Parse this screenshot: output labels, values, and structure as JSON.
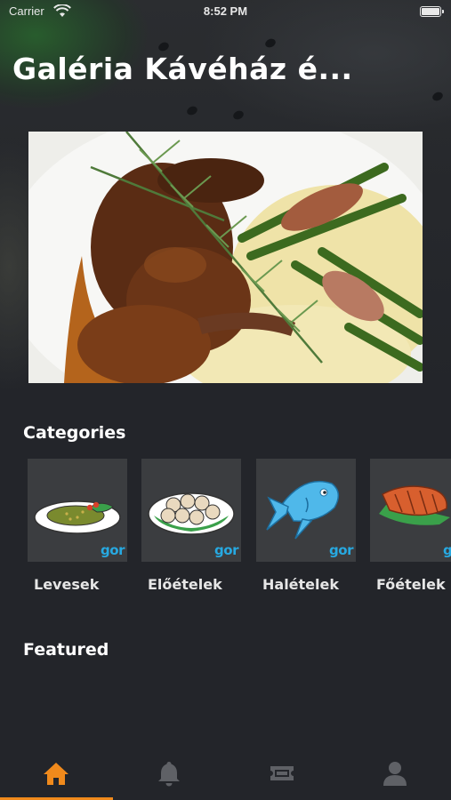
{
  "status_bar": {
    "carrier": "Carrier",
    "time": "8:52 PM"
  },
  "header": {
    "title": "Galéria Kávéház é..."
  },
  "sections": {
    "categories_title": "Categories",
    "featured_title": "Featured"
  },
  "categories": [
    {
      "label": "Levesek",
      "icon": "soup-plate-icon"
    },
    {
      "label": "Előételek",
      "icon": "appetizer-plate-icon"
    },
    {
      "label": "Halételek",
      "icon": "fish-icon"
    },
    {
      "label": "Főételek",
      "icon": "steak-icon"
    }
  ],
  "category_badge": "gor",
  "tab_bar": {
    "active_tab": "home",
    "tabs": [
      "home-icon",
      "bell-icon",
      "ticket-icon",
      "user-icon"
    ],
    "active_color": "#f08a1c",
    "inactive_color": "#5f6166"
  },
  "colors": {
    "background": "#23252a",
    "tile": "#3b3d40",
    "badge": "#27a9e1"
  }
}
